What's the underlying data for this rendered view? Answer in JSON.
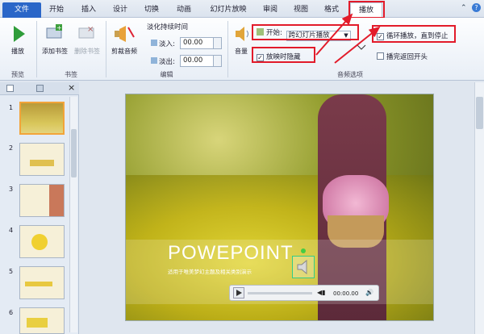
{
  "tabs": {
    "file": "文件",
    "start": "开始",
    "insert": "插入",
    "design": "设计",
    "transitions": "切换",
    "animations": "动画",
    "slideshow": "幻灯片放映",
    "review": "审阅",
    "view": "视图",
    "format": "格式",
    "playback": "播放"
  },
  "ribbon": {
    "play_label": "播放",
    "add_bookmark": "添加书签",
    "remove_bookmark": "删除书签",
    "trim_audio": "剪裁音频",
    "fade_title": "淡化持续时间",
    "fade_in_label": "淡入:",
    "fade_in_value": "00.00",
    "fade_out_label": "淡出:",
    "fade_out_value": "00.00",
    "volume": "音量",
    "start_label": "开始:",
    "start_value": "跨幻灯片播放",
    "hide_label": "放映时隐藏",
    "loop_label": "循环播放，直到停止",
    "rewind_label": "播完返回开头",
    "groups": {
      "preview": "预览",
      "bookmarks": "书签",
      "editing": "编辑",
      "audio_options": "音频选项"
    }
  },
  "slides": [
    "1",
    "2",
    "3",
    "4",
    "5",
    "6"
  ],
  "slide": {
    "title": "POWEPOINT",
    "subtitle": "适用于唯美梦幻主题及相关类别演示",
    "time": "00:00.00"
  },
  "colors": {
    "accent": "#2a66c8",
    "highlight": "#e21b2a",
    "title": "#ffffff"
  }
}
